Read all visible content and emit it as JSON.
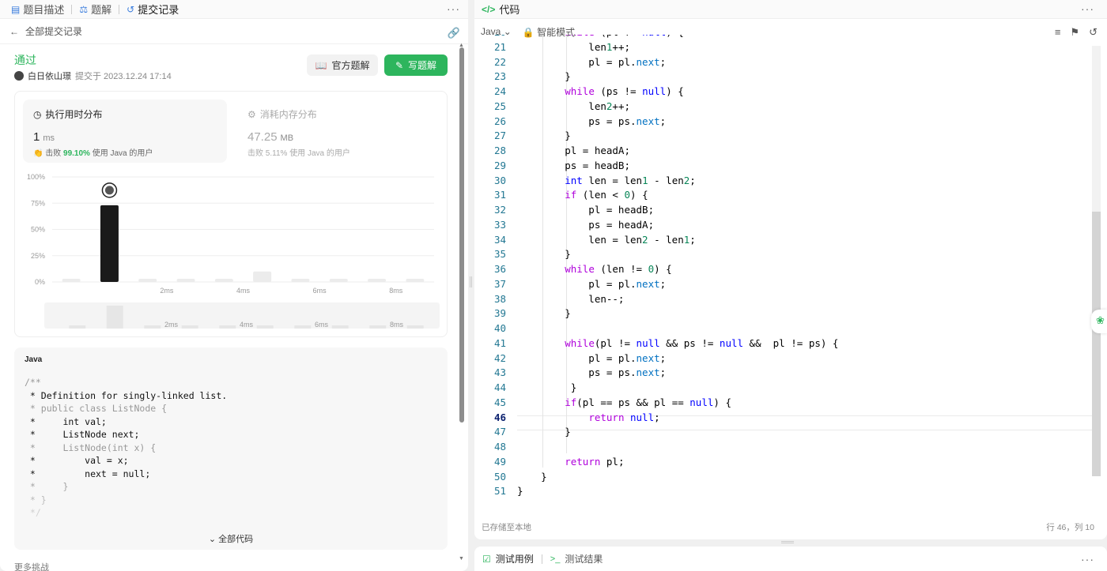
{
  "left_panel": {
    "tabs": [
      {
        "label": "题目描述",
        "icon": "document-icon"
      },
      {
        "label": "题解",
        "icon": "flask-icon"
      },
      {
        "label": "提交记录",
        "icon": "history-icon"
      }
    ],
    "more_label": "···",
    "back_label": "全部提交记录",
    "status": "通过",
    "submitter": "白日依山璟",
    "submitted_at": "提交于 2023.12.24 17:14",
    "official_solution_label": "官方题解",
    "write_solution_label": "写题解",
    "runtime": {
      "title": "执行用时分布",
      "value": "1",
      "unit": "ms",
      "beat_prefix": "击败",
      "beat_pct": "99.10%",
      "beat_suffix": "使用 Java 的用户"
    },
    "memory": {
      "title": "消耗内存分布",
      "value": "47.25",
      "unit": "MB",
      "beat_prefix": "击败",
      "beat_pct": "5.11%",
      "beat_suffix": "使用 Java 的用户"
    },
    "code_lang": "Java",
    "code_preview": [
      {
        "text": "/**",
        "dim": true
      },
      {
        "text": " * Definition for singly-linked list.",
        "dim": false
      },
      {
        "text": " * public class ListNode {",
        "dim": true
      },
      {
        "text": " *     int val;",
        "dim": false
      },
      {
        "text": " *     ListNode next;",
        "dim": false
      },
      {
        "text": " *     ListNode(int x) {",
        "dim": true
      },
      {
        "text": " *         val = x;",
        "dim": false
      },
      {
        "text": " *         next = null;",
        "dim": false
      },
      {
        "text": " *     }",
        "dim": true
      },
      {
        "text": " * }",
        "dim": true
      },
      {
        "text": " */",
        "dim": true
      }
    ],
    "all_code_label": "全部代码",
    "more_challenges_label": "更多挑战"
  },
  "chart_data": {
    "type": "bar",
    "ylabel": "",
    "yticks": [
      "100%",
      "75%",
      "50%",
      "25%",
      "0%"
    ],
    "ylim": [
      0,
      100
    ],
    "xticks": [
      {
        "label": "2ms",
        "index": 3
      },
      {
        "label": "4ms",
        "index": 5
      },
      {
        "label": "6ms",
        "index": 7
      },
      {
        "label": "8ms",
        "index": 9
      }
    ],
    "values": [
      3,
      73,
      3,
      3,
      3,
      10,
      3,
      3,
      3,
      3
    ],
    "highlight_index": 1,
    "highlight_color": "#1a1a1a",
    "bar_color": "#ececec",
    "brush_values": [
      3,
      23,
      3,
      3,
      3,
      3,
      3,
      3,
      3,
      3
    ],
    "brush_xticks": [
      {
        "label": "2ms",
        "index": 3
      },
      {
        "label": "4ms",
        "index": 5
      },
      {
        "label": "6ms",
        "index": 7
      },
      {
        "label": "8ms",
        "index": 9
      }
    ]
  },
  "right_panel": {
    "title": "代码",
    "more_label": "···",
    "language": "Java",
    "mode": "智能模式",
    "saved_status": "已存储至本地",
    "cursor_pos": "行 46，列 10",
    "current_line": 46,
    "first_line": 20,
    "code": [
      "        while (pl != null) {",
      "            len1++;",
      "            pl = pl.next;",
      "        }",
      "        while (ps != null) {",
      "            len2++;",
      "            ps = ps.next;",
      "        }",
      "        pl = headA;",
      "        ps = headB;",
      "        int len = len1 - len2;",
      "        if (len < 0) {",
      "            pl = headB;",
      "            ps = headA;",
      "            len = len2 - len1;",
      "        }",
      "        while (len != 0) {",
      "            pl = pl.next;",
      "            len--;",
      "        }",
      "",
      "        while(pl != null && ps != null &&  pl != ps) {",
      "            pl = pl.next;",
      "            ps = ps.next;",
      "         }",
      "        if(pl == ps && pl == null) {",
      "            return null;",
      "        }",
      "",
      "        return pl;",
      "    }",
      "}"
    ]
  },
  "bottom_panel": {
    "tabs": [
      {
        "label": "测试用例",
        "icon": "checkbox-icon"
      },
      {
        "label": "测试结果",
        "icon": "terminal-icon"
      }
    ],
    "more_label": "···"
  },
  "colors": {
    "accent": "#2db55d",
    "keyword": "#af00db",
    "type": "#0000ff",
    "property": "#0070c1",
    "number": "#098658",
    "line_number": "#237893"
  }
}
